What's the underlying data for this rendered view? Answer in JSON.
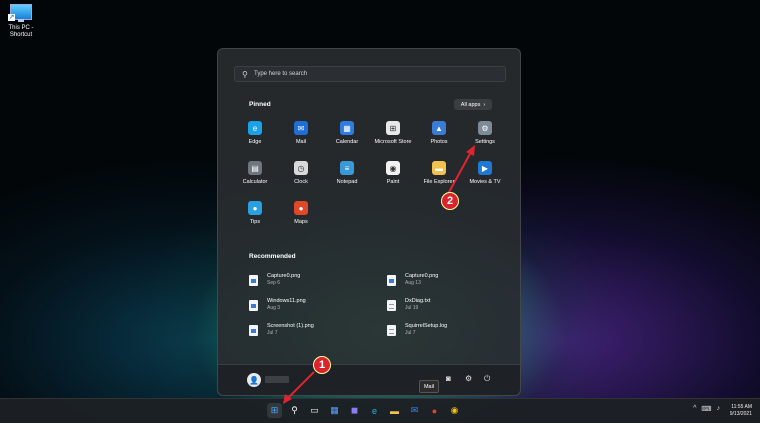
{
  "desktop": {
    "shortcut_label": "This PC - Shortcut"
  },
  "start": {
    "search_placeholder": "Type here to search",
    "pinned_title": "Pinned",
    "all_apps_label": "All apps",
    "apps": [
      {
        "name": "Edge",
        "icon": "edge-icon",
        "color": "#1aa1e6",
        "glyph": "e"
      },
      {
        "name": "Mail",
        "icon": "mail-icon",
        "color": "#1f6fd6",
        "glyph": "✉"
      },
      {
        "name": "Calendar",
        "icon": "calendar-icon",
        "color": "#2f7de1",
        "glyph": "▦"
      },
      {
        "name": "Microsoft Store",
        "icon": "store-icon",
        "color": "#e8e8e8",
        "glyph": "⊞"
      },
      {
        "name": "Photos",
        "icon": "photos-icon",
        "color": "#3a7bd5",
        "glyph": "▲"
      },
      {
        "name": "Settings",
        "icon": "gear-icon",
        "color": "#7d8b99",
        "glyph": "⚙"
      },
      {
        "name": "Calculator",
        "icon": "calculator-icon",
        "color": "#6f7680",
        "glyph": "▤"
      },
      {
        "name": "Clock",
        "icon": "clock-icon",
        "color": "#d9d9d9",
        "glyph": "◷"
      },
      {
        "name": "Notepad",
        "icon": "notepad-icon",
        "color": "#3a9ad9",
        "glyph": "≡"
      },
      {
        "name": "Paint",
        "icon": "paint-icon",
        "color": "#f2f2f2",
        "glyph": "◉"
      },
      {
        "name": "File Explorer",
        "icon": "folder-icon",
        "color": "#f2c14e",
        "glyph": "▬"
      },
      {
        "name": "Movies & TV",
        "icon": "movies-icon",
        "color": "#1f78d1",
        "glyph": "▶"
      },
      {
        "name": "Tips",
        "icon": "tips-icon",
        "color": "#2aa0e0",
        "glyph": "●"
      },
      {
        "name": "Maps",
        "icon": "maps-icon",
        "color": "#e0472b",
        "glyph": "●"
      }
    ],
    "recommended_title": "Recommended",
    "recommended": [
      {
        "name": "Capture0.png",
        "date": "Sep 6",
        "kind": "img"
      },
      {
        "name": "Capture0.png",
        "date": "Aug 13",
        "kind": "img"
      },
      {
        "name": "Windows11.png",
        "date": "Aug 3",
        "kind": "img"
      },
      {
        "name": "DxDiag.txt",
        "date": "Jul 19",
        "kind": "txt"
      },
      {
        "name": "Screenshot (1).png",
        "date": "Jul 7",
        "kind": "img"
      },
      {
        "name": "SquirrelSetup.log",
        "date": "Jul 7",
        "kind": "txt"
      }
    ],
    "tooltip": "Mail"
  },
  "taskbar": {
    "icons": [
      "start-icon",
      "search-icon",
      "task-view-icon",
      "widgets-icon",
      "chat-icon",
      "edge-icon",
      "file-explorer-icon",
      "mail-icon",
      "maps-icon",
      "chrome-icon"
    ],
    "clock_time": "11:55 AM",
    "clock_date": "9/13/2021"
  },
  "annotations": {
    "step1": "1",
    "step2": "2"
  }
}
